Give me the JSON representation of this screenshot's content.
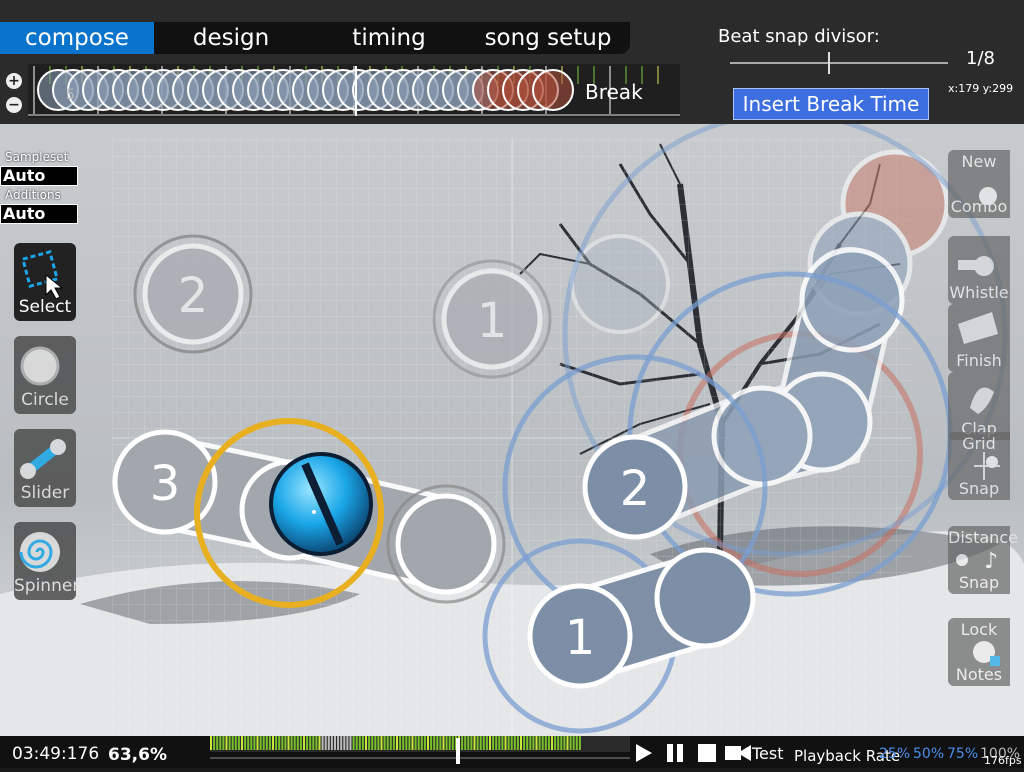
{
  "tabs": [
    {
      "label": "compose",
      "active": true
    },
    {
      "label": "design",
      "active": false
    },
    {
      "label": "timing",
      "active": false
    },
    {
      "label": "song setup",
      "active": false
    }
  ],
  "timeline": {
    "zoom_in": "+",
    "zoom_out": "−",
    "break_label": "Break",
    "marker_number": "5"
  },
  "beat_snap": {
    "label": "Beat snap divisor:",
    "value": "1/8",
    "fraction": 0.45
  },
  "coords": "x:179 y:299",
  "insert_break_button": "Insert Break Time",
  "sampleset": {
    "sampleset_label": "Sampleset",
    "sampleset_value": "Auto",
    "additions_label": "Additions",
    "additions_value": "Auto"
  },
  "left_tools": [
    {
      "label": "Select",
      "icon": "select-icon",
      "active": true
    },
    {
      "label": "Circle",
      "icon": "circle-icon",
      "active": false
    },
    {
      "label": "Slider",
      "icon": "slider-icon",
      "active": false
    },
    {
      "label": "Spinner",
      "icon": "spinner-icon",
      "active": false
    }
  ],
  "right_tools": [
    {
      "top": "New",
      "bottom": "Combo",
      "icon": "new-combo-icon"
    },
    {
      "top": "",
      "bottom": "Whistle",
      "icon": "whistle-icon"
    },
    {
      "top": "",
      "bottom": "Finish",
      "icon": "finish-icon"
    },
    {
      "top": "",
      "bottom": "Clap",
      "icon": "clap-icon"
    },
    {
      "top": "Grid",
      "bottom": "Snap",
      "icon": "grid-snap-icon"
    },
    {
      "top": "Distance",
      "bottom": "Snap",
      "icon": "distance-snap-icon"
    },
    {
      "top": "Lock",
      "bottom": "Notes",
      "icon": "lock-notes-icon"
    }
  ],
  "hit_objects": {
    "n1": "2",
    "n2": "1",
    "n3": "3",
    "n4": "2",
    "n5": "1"
  },
  "bottom": {
    "time": "03:49:176",
    "percent": "63,6%",
    "test_label": "Test",
    "playback_rate_label": "Playback Rate",
    "rates": [
      "25%",
      "50%",
      "75%",
      "100%"
    ],
    "fps": "176fps"
  },
  "colors": {
    "accent": "#0a74cc",
    "break_button": "#3d6ee0",
    "selected_circle": "#e8b020",
    "approach_circle": "#7a9ed0"
  }
}
